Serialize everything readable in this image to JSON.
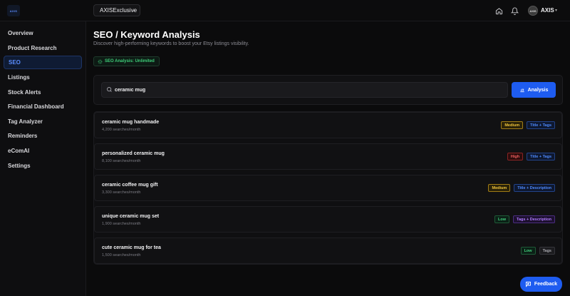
{
  "logo": {
    "text": "AXIS"
  },
  "topbar": {
    "workspace": "AXISExclusive",
    "username": "AXIS",
    "avatar_text": "AXIS"
  },
  "sidebar": {
    "items": [
      {
        "label": "Overview"
      },
      {
        "label": "Product Research"
      },
      {
        "label": "SEO"
      },
      {
        "label": "Listings"
      },
      {
        "label": "Stock Alerts"
      },
      {
        "label": "Financial Dashboard"
      },
      {
        "label": "Tag Analyzer"
      },
      {
        "label": "Reminders"
      },
      {
        "label": "eComAI"
      },
      {
        "label": "Settings"
      }
    ]
  },
  "main": {
    "title": "SEO / Keyword Analysis",
    "subtitle": "Discover high-performing keywords to boost your Etsy listings visibility.",
    "badge": "SEO Analysis: Unlimited",
    "search": {
      "value": "ceramic mug",
      "button": "Analysis"
    },
    "keywords": [
      {
        "keyword": "ceramic mug handmade",
        "searches": "4,200 searches/month",
        "competition": "Medium",
        "placement": "Title + Tags"
      },
      {
        "keyword": "personalized ceramic mug",
        "searches": "8,100 searches/month",
        "competition": "High",
        "placement": "Title + Tags"
      },
      {
        "keyword": "ceramic coffee mug gift",
        "searches": "3,300 searches/month",
        "competition": "Medium",
        "placement": "Title + Description"
      },
      {
        "keyword": "unique ceramic mug set",
        "searches": "1,900 searches/month",
        "competition": "Low",
        "placement": "Tags + Description"
      },
      {
        "keyword": "cute ceramic mug for tea",
        "searches": "1,500 searches/month",
        "competition": "Low",
        "placement": "Tags"
      }
    ]
  },
  "feedback": {
    "label": "Feedback"
  },
  "colors": {
    "accent": "#1e5cf0",
    "background": "#0b0b0c",
    "success": "#3ecf7a"
  }
}
